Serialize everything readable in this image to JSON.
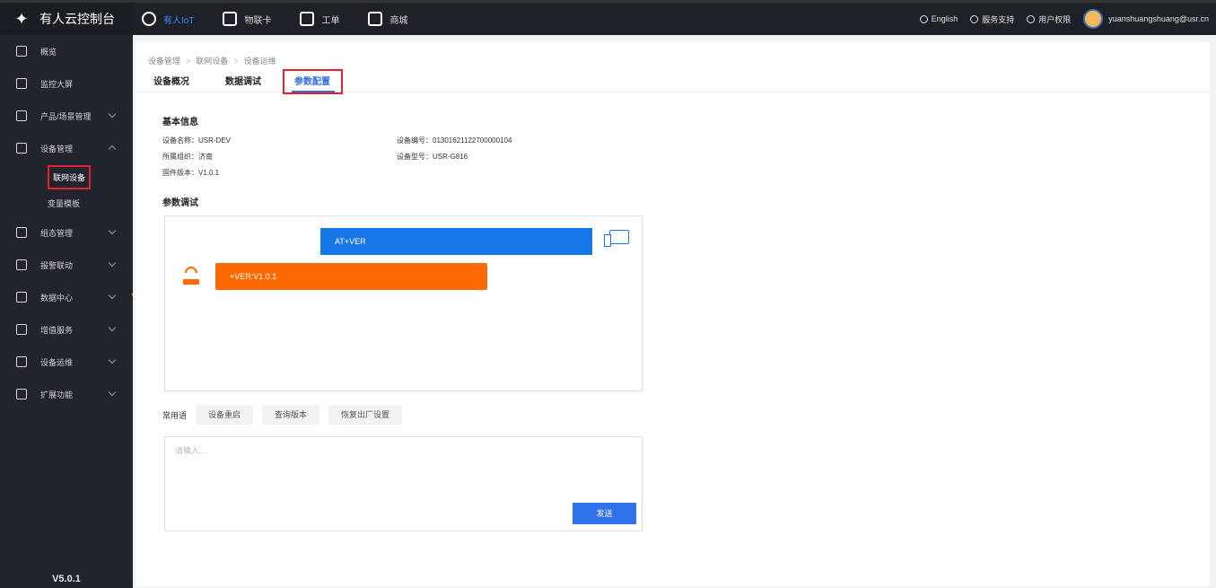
{
  "app": {
    "title": "有人云控制台",
    "version": "V5.0.1"
  },
  "topnav": [
    {
      "label": "有人IoT",
      "icon": "cloud-icon",
      "active": true
    },
    {
      "label": "物联卡",
      "icon": "sim-card-icon",
      "active": false
    },
    {
      "label": "工单",
      "icon": "ticket-icon",
      "active": false
    },
    {
      "label": "商城",
      "icon": "shop-icon",
      "active": false
    }
  ],
  "topright": {
    "language": "English",
    "support": "服务支持",
    "permissions": "用户权限",
    "user": "yuanshuangshuang@usr.cn"
  },
  "sidebar": {
    "items": [
      {
        "label": "概览",
        "icon": "overview-icon",
        "chevron": false
      },
      {
        "label": "监控大屏",
        "icon": "monitor-icon",
        "chevron": false
      },
      {
        "label": "产品/场景管理",
        "icon": "cube-icon",
        "chevron": true
      },
      {
        "label": "设备管理",
        "icon": "device-icon",
        "chevron": true,
        "expanded": true
      },
      {
        "label": "组态管理",
        "icon": "image-icon",
        "chevron": true
      },
      {
        "label": "报警联动",
        "icon": "alarm-icon",
        "chevron": true
      },
      {
        "label": "数据中心",
        "icon": "bar-chart-icon",
        "chevron": true
      },
      {
        "label": "增值服务",
        "icon": "coin-icon",
        "chevron": true
      },
      {
        "label": "设备运维",
        "icon": "maintenance-icon",
        "chevron": true
      },
      {
        "label": "扩展功能",
        "icon": "layers-icon",
        "chevron": true
      }
    ],
    "subitems": [
      {
        "label": "联网设备",
        "selected": true
      },
      {
        "label": "变量模板",
        "selected": false
      }
    ]
  },
  "breadcrumb": [
    "设备管理",
    "联网设备",
    "设备运维"
  ],
  "tabs": [
    {
      "label": "设备概况",
      "active": false
    },
    {
      "label": "数据调试",
      "active": false
    },
    {
      "label": "参数配置",
      "active": true
    }
  ],
  "basic_info": {
    "title": "基本信息",
    "device_name": "设备名称：USR-DEV",
    "org": "所属组织：济南",
    "firmware": "固件版本：V1.0.1",
    "device_no": "设备编号：01301621122700000104",
    "device_model": "设备型号：USR-G816"
  },
  "debug": {
    "title": "参数调试",
    "command": "AT+VER",
    "response": "+VER:V1.0.1"
  },
  "phrases": {
    "label": "常用语",
    "buttons": [
      "设备重启",
      "查询版本",
      "恢复出厂设置"
    ]
  },
  "input": {
    "placeholder": "请输入...",
    "send_label": "发送"
  },
  "colors": {
    "accent": "#2f72ea",
    "command_bar": "#1677e6",
    "response_bar": "#ff6a00",
    "highlight": "#e4212d",
    "sidebar_bg": "#22252d"
  }
}
